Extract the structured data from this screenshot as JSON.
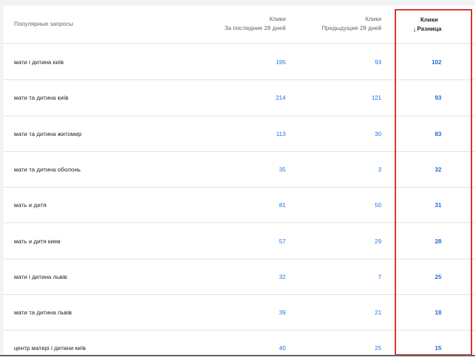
{
  "header": {
    "query_label": "Популярные запросы",
    "c1_line1": "Клики",
    "c1_line2": "За последние 28 дней",
    "c2_line1": "Клики",
    "c2_line2": "Предыдущие 28 дней",
    "c3_line1": "Клики",
    "c3_line2": "Разница",
    "sort_icon": "arrow-down-icon"
  },
  "rows": [
    {
      "query": "мати і дитина київ",
      "current": "195",
      "previous": "93",
      "diff": "102"
    },
    {
      "query": "мати та дитина київ",
      "current": "214",
      "previous": "121",
      "diff": "93"
    },
    {
      "query": "мати та дитина житомир",
      "current": "113",
      "previous": "30",
      "diff": "83"
    },
    {
      "query": "мати та дитина оболонь",
      "current": "35",
      "previous": "3",
      "diff": "32"
    },
    {
      "query": "мать и дитя",
      "current": "81",
      "previous": "50",
      "diff": "31"
    },
    {
      "query": "мать и дитя киев",
      "current": "57",
      "previous": "29",
      "diff": "28"
    },
    {
      "query": "мати і дитина львів",
      "current": "32",
      "previous": "7",
      "diff": "25"
    },
    {
      "query": "мати та дитина львів",
      "current": "39",
      "previous": "21",
      "diff": "18"
    },
    {
      "query": "центр матері і дитини київ",
      "current": "40",
      "previous": "25",
      "diff": "15"
    }
  ]
}
